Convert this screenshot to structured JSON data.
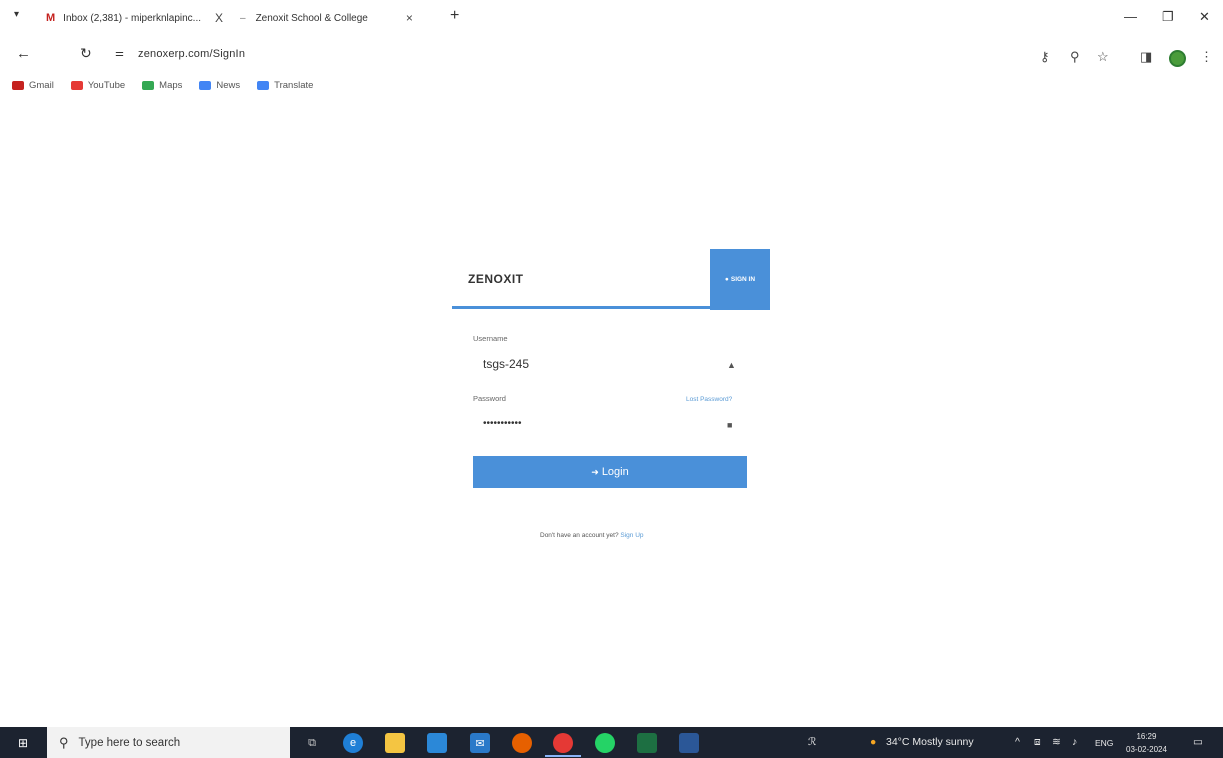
{
  "browser": {
    "tabs": [
      {
        "label": "Inbox (2,381) - miperknlapinc...",
        "close": "X"
      },
      {
        "label": "Zenoxit School & College",
        "close": "×"
      }
    ],
    "new_tab": "+",
    "url": "zenoxerp.com/SignIn",
    "bookmarks": [
      {
        "label": "Gmail",
        "color": "#c5221f"
      },
      {
        "label": "YouTube",
        "color": "#e53935"
      },
      {
        "label": "Maps",
        "color": "#34a853"
      },
      {
        "label": "News",
        "color": "#4285f4"
      },
      {
        "label": "Translate",
        "color": "#4285f4"
      }
    ]
  },
  "login": {
    "brand": "ZENOXIT",
    "signin_tab": "SIGN IN",
    "username_label": "Username",
    "username_value": "tsgs-245",
    "password_label": "Password",
    "password_value": "•••••••••••",
    "forgot": "Lost Password?",
    "login_button": "Login",
    "signup_prefix": "Don't have an account yet?",
    "signup_link": "Sign Up"
  },
  "taskbar": {
    "search_placeholder": "Type here to search",
    "weather": "34°C  Mostly sunny",
    "language": "ENG",
    "time": "16:29",
    "date": "03-02-2024",
    "accent": "#1c2330"
  }
}
